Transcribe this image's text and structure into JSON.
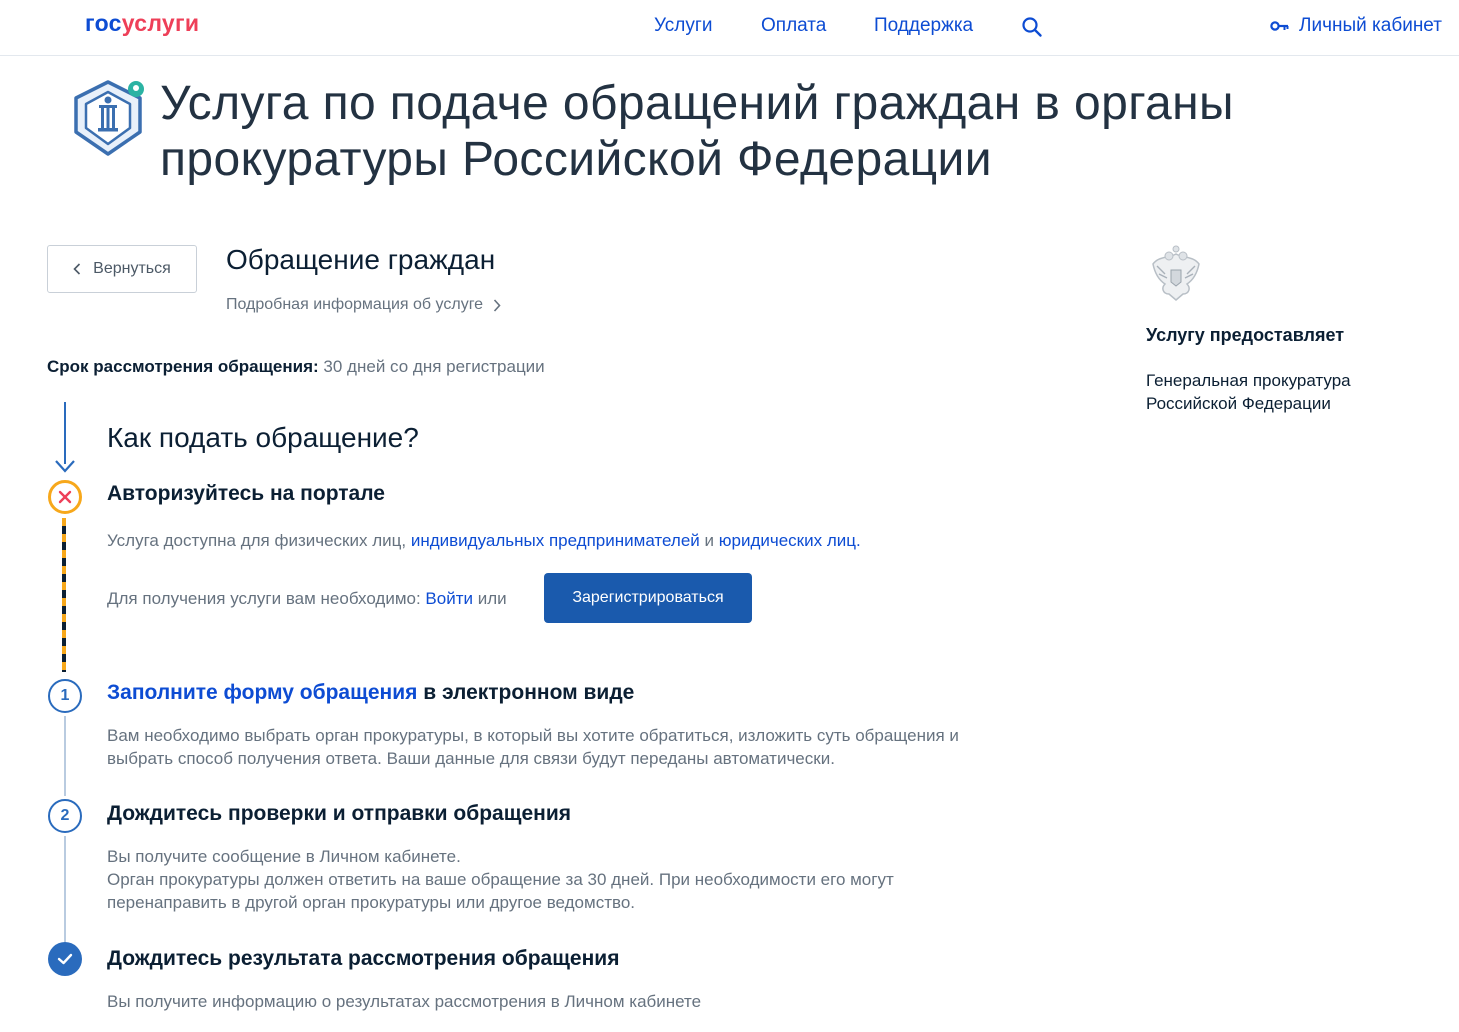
{
  "header": {
    "logo_part1": "гос",
    "logo_part2": "услуги",
    "nav": [
      "Услуги",
      "Оплата",
      "Поддержка"
    ],
    "cabinet_label": "Личный кабинет"
  },
  "page": {
    "title": "Услуга по подаче обращений граждан в органы прокуратуры Российской Федерации"
  },
  "back_label": "Вернуться",
  "service": {
    "name": "Обращение граждан",
    "details_link": "Подробная информация об услуге"
  },
  "term": {
    "label": "Срок рассмотрения обращения:",
    "value": "30 дней со дня регистрации"
  },
  "provider": {
    "heading": "Услугу предоставляет",
    "name": "Генеральная прокуратура Российской Федерации"
  },
  "how": {
    "title": "Как подать обращение?"
  },
  "step_auth": {
    "title": "Авторизуйтесь на портале",
    "avail_prefix": "Услуга доступна для физических лиц,",
    "avail_link1": "индивидуальных предпринимателей",
    "avail_and": "и",
    "avail_link2": "юридических лиц",
    "avail_end": ".",
    "need_prefix": "Для получения услуги вам необходимо:",
    "login_link": "Войти",
    "or": "или",
    "register_label": "Зарегистрироваться"
  },
  "step1": {
    "number": "1",
    "title_link": "Заполните форму обращения",
    "title_rest": "в электронном виде",
    "text": "Вам необходимо выбрать орган прокуратуры, в который вы хотите обратиться, изложить суть обращения и выбрать способ получения ответа. Ваши данные для связи будут переданы автоматически."
  },
  "step2": {
    "number": "2",
    "title": "Дождитесь проверки и отправки обращения",
    "text_line1": "Вы получите сообщение в Личном кабинете.",
    "text_line2": "Орган прокуратуры должен ответить на ваше обращение за 30 дней. При необходимости его могут перенаправить в другой орган прокуратуры или другое ведомство."
  },
  "step3": {
    "title": "Дождитесь результата рассмотрения обращения",
    "text": "Вы получите информацию о результатах рассмотрения в Личном кабинете"
  },
  "colors": {
    "accent_blue": "#0d4cd3",
    "logo_red": "#ee3f58",
    "error_orange": "#f7a81b",
    "step_blue": "#2a6bbd",
    "text_gray": "#66727f"
  }
}
